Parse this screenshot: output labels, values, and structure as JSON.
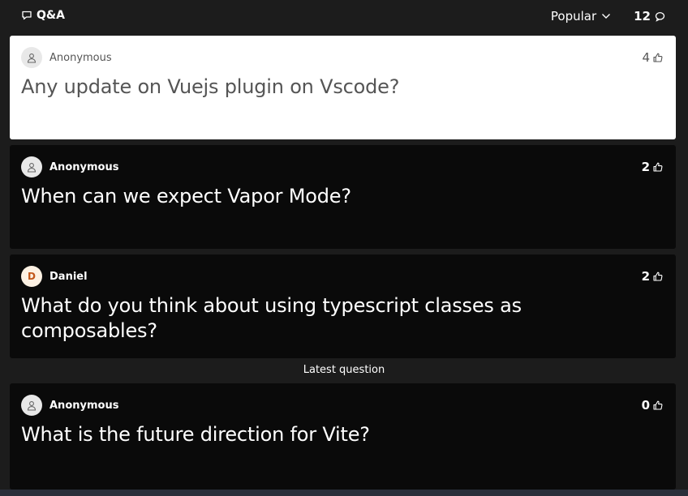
{
  "header": {
    "title": "Q&A",
    "sort_label": "Popular",
    "question_count": "12"
  },
  "questions": [
    {
      "author": "Anonymous",
      "avatar_type": "user-icon",
      "text": "Any update on Vuejs plugin on Vscode?",
      "votes": "4",
      "highlighted": true
    },
    {
      "author": "Anonymous",
      "avatar_type": "user-icon",
      "text": "When can we expect Vapor Mode?",
      "votes": "2",
      "highlighted": false
    },
    {
      "author": "Daniel",
      "avatar_type": "letter",
      "avatar_letter": "D",
      "text": "What do you think about using typescript classes as composables?",
      "votes": "2",
      "highlighted": false
    }
  ],
  "latest_label": "Latest question",
  "latest": {
    "author": "Anonymous",
    "avatar_type": "user-icon",
    "text": "What is the future direction for Vite?",
    "votes": "0"
  },
  "colors": {
    "background": "#1c1c1c",
    "card": "#0a0a0a",
    "highlight_card": "#ffffff",
    "avatar_letter_bg": "#fdf1e3",
    "avatar_letter_fg": "#c2571a"
  }
}
